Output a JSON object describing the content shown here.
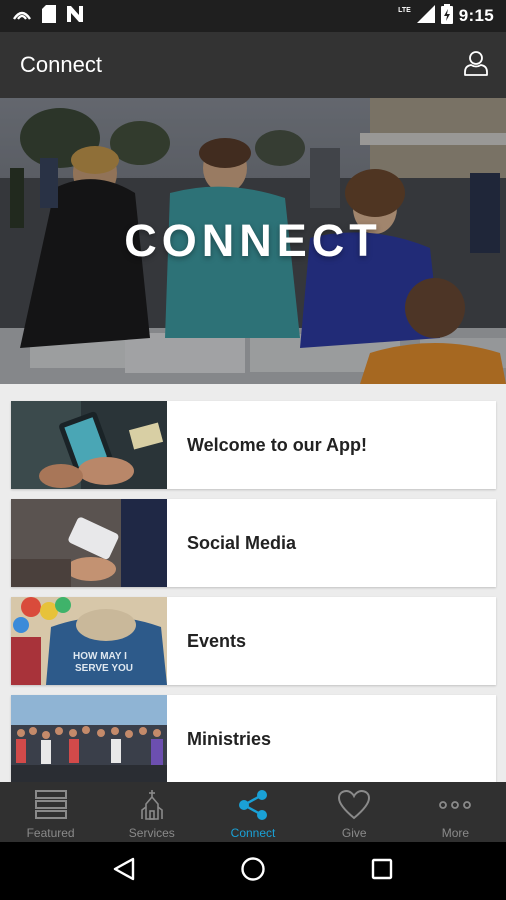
{
  "status_bar": {
    "time": "9:15",
    "network_label": "LTE",
    "icons": [
      "cast-icon",
      "sd-card-icon",
      "n-icon",
      "signal-icon",
      "battery-icon"
    ]
  },
  "app_bar": {
    "title": "Connect",
    "profile_icon": "user-icon"
  },
  "hero": {
    "title": "CONNECT"
  },
  "cards": [
    {
      "label": "Welcome to our App!",
      "thumb": "phone-hands-image"
    },
    {
      "label": "Social Media",
      "thumb": "phone-hand-image"
    },
    {
      "label": "Events",
      "thumb": "volunteer-hoodie-image"
    },
    {
      "label": "Ministries",
      "thumb": "crowd-image"
    }
  ],
  "tabs": [
    {
      "label": "Featured",
      "icon": "stack-icon",
      "active": false
    },
    {
      "label": "Services",
      "icon": "church-icon",
      "active": false
    },
    {
      "label": "Connect",
      "icon": "share-icon",
      "active": true
    },
    {
      "label": "Give",
      "icon": "heart-icon",
      "active": false
    },
    {
      "label": "More",
      "icon": "more-dots-icon",
      "active": false
    }
  ],
  "colors": {
    "status_bar": "#1f1f1f",
    "app_bar": "#333333",
    "tab_bar": "#303030",
    "accent": "#1aa1d6",
    "inactive": "#8a8a8a"
  }
}
